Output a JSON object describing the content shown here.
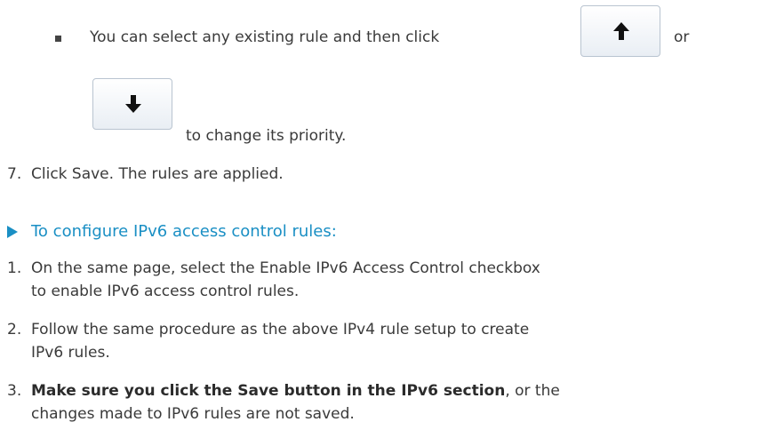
{
  "bullet": {
    "text_before": "You can select any existing rule and then click",
    "text_or": "or",
    "text_after": "to change its priority.",
    "up_button_icon": "arrow-up-icon",
    "down_button_icon": "arrow-down-icon"
  },
  "step7": {
    "number": "7.",
    "text": "Click Save. The rules are applied."
  },
  "section": {
    "heading": "To configure IPv6 access control rules:",
    "accent_color": "#1a8fc4"
  },
  "steps": [
    {
      "number": "1.",
      "line1": "On the same page, select the Enable IPv6 Access Control checkbox",
      "line2": "to enable IPv6 access control rules."
    },
    {
      "number": "2.",
      "line1": "Follow the same procedure as the above IPv4 rule setup to create",
      "line2": "IPv6 rules."
    },
    {
      "number": "3.",
      "bold": "Make sure you click the Save button in the IPv6 section",
      "line1_rest": ", or the",
      "line2": "changes made to IPv6 rules are not saved."
    }
  ]
}
